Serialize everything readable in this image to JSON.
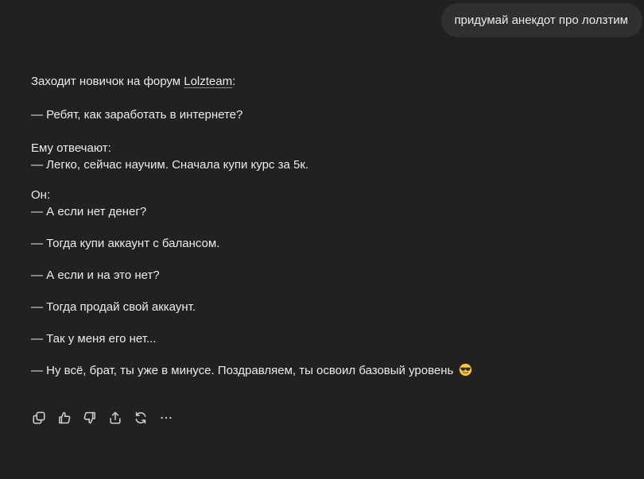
{
  "user_message": {
    "text": "придумай анекдот про лолзтим"
  },
  "assistant_message": {
    "intro_before_link": "Заходит новичок на форум ",
    "intro_link": "Lolzteam",
    "intro_after_link": ":",
    "lines": [
      "— Ребят, как заработать в интернете?",
      "Ему отвечают:",
      "— Легко, сейчас научим. Сначала купи курс за 5к.",
      "Он:",
      "— А если нет денег?",
      "— Тогда купи аккаунт с балансом.",
      "— А если и на это нет?",
      "— Тогда продай свой аккаунт.",
      "— Так у меня его нет...",
      "— Ну всё, брат, ты уже в минусе. Поздравляем, ты освоил базовый уровень "
    ],
    "final_emoji": "smiling-face-with-sunglasses"
  },
  "actions": [
    {
      "icon": "copy-icon"
    },
    {
      "icon": "thumbs-up-icon"
    },
    {
      "icon": "thumbs-down-icon"
    },
    {
      "icon": "share-icon"
    },
    {
      "icon": "regenerate-icon"
    },
    {
      "icon": "more-icon"
    }
  ],
  "colors": {
    "background": "#212121",
    "bubble": "#303030",
    "text": "#ececec",
    "icon": "#cfcfcf"
  }
}
